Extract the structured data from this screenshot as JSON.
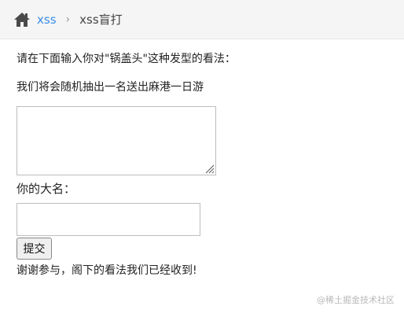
{
  "breadcrumb": {
    "home_icon": "home-icon",
    "link_label": "xss",
    "separator": "›",
    "current_label": "xss盲打"
  },
  "form": {
    "prompt_line1": "请在下面输入你对\"锅盖头\"这种发型的看法：",
    "prompt_line2": "我们将会随机抽出一名送出麻港一日游",
    "opinion_value": "",
    "name_label": "你的大名：",
    "name_value": "",
    "submit_label": "提交",
    "result_message": "谢谢参与，阁下的看法我们已经收到!"
  },
  "watermark": "@稀土掘金技术社区",
  "colors": {
    "link": "#3a8ee6",
    "breadcrumb_bg": "#f5f5f5"
  }
}
